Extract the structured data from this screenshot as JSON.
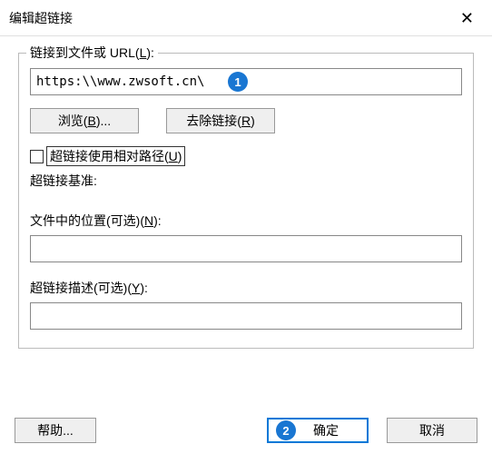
{
  "title": "编辑超链接",
  "group1": {
    "label_prefix": "链接到文件或 URL(",
    "label_key": "L",
    "label_suffix": "):",
    "url_value": "https:\\\\www.zwsoft.cn\\",
    "browse_prefix": "浏览(",
    "browse_key": "B",
    "browse_suffix": ")...",
    "remove_prefix": "去除链接(",
    "remove_key": "R",
    "remove_suffix": ")",
    "relative_prefix": "超链接使用相对路径(",
    "relative_key": "U",
    "relative_suffix": ")",
    "base_label": "超链接基准:"
  },
  "group2": {
    "position_prefix": "文件中的位置(可选)(",
    "position_key": "N",
    "position_suffix": "):",
    "position_value": "",
    "desc_prefix": "超链接描述(可选)(",
    "desc_key": "Y",
    "desc_suffix": "):",
    "desc_value": ""
  },
  "footer": {
    "help": "帮助...",
    "ok": "确定",
    "cancel": "取消"
  },
  "annotations": {
    "b1": "1",
    "b2": "2"
  }
}
